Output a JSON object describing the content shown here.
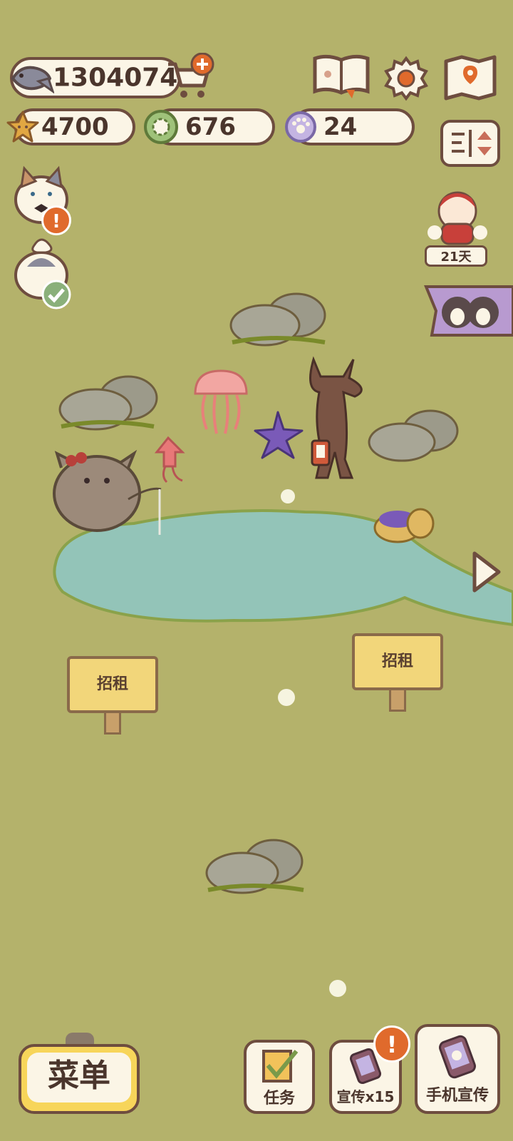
{
  "currencies": {
    "fish": "1304074",
    "stars": "4700",
    "leaves": "676",
    "paws": "24"
  },
  "visitor": {
    "days": "21天"
  },
  "signs": [
    {
      "label": "招租"
    },
    {
      "label": "招租"
    }
  ],
  "bottom": {
    "menu": "菜单",
    "tasks": "任务",
    "promote_x15": "宣传x15",
    "phone_promote": "手机宣传",
    "alert_mark": "!"
  },
  "colors": {
    "grass": "#b4b26b",
    "pond": "#93c4b8",
    "outline": "#6e4d3f",
    "cream": "#fbf5e6",
    "alert": "#e06a2c"
  },
  "icons": [
    "fish-icon",
    "cart-plus-icon",
    "paw-book-icon",
    "gear-icon",
    "map-icon",
    "star-icon",
    "leaf-coin-icon",
    "paw-coin-icon",
    "sort-toggle-icon",
    "arrow-right-icon",
    "check-icon",
    "phone-icon"
  ]
}
